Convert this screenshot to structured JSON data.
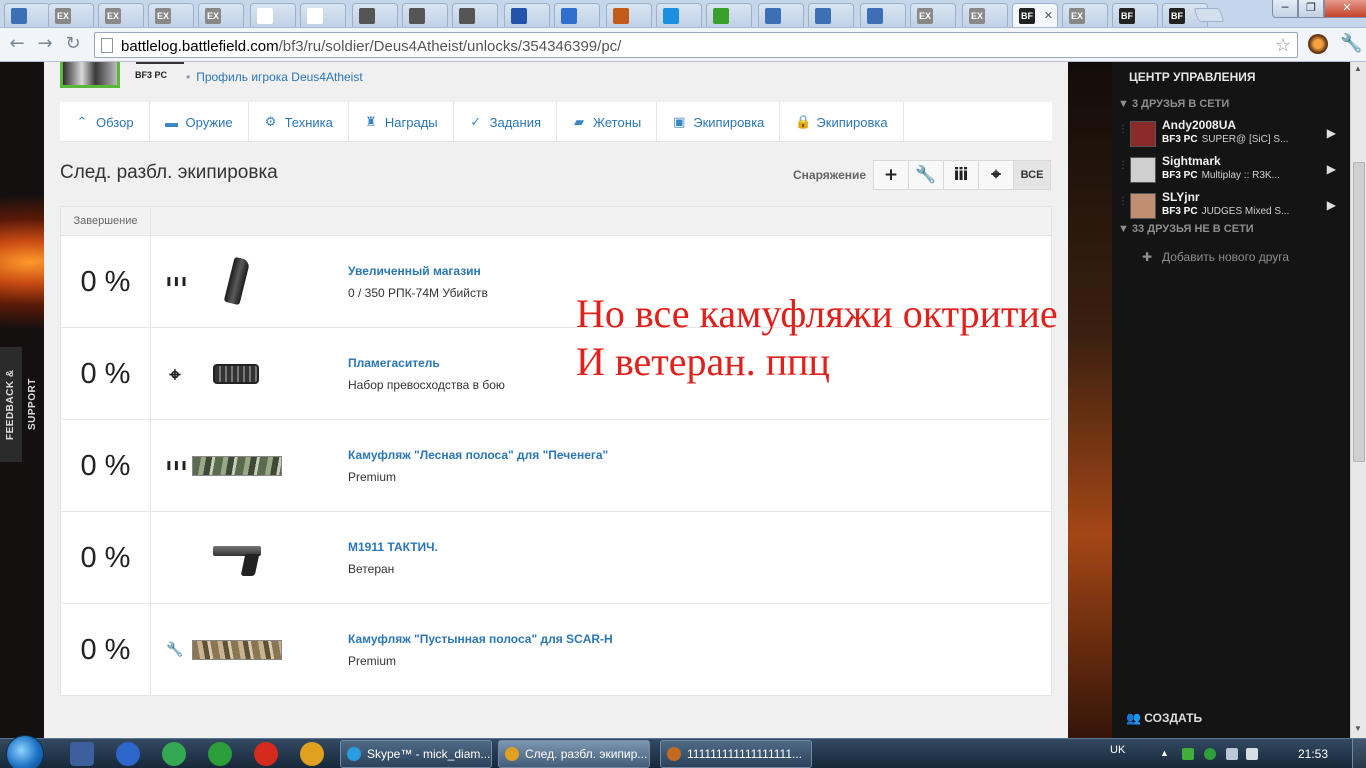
{
  "browser": {
    "tabs": [
      {
        "label": "",
        "icon": "pause-icon",
        "color": "#3d6fb5"
      },
      {
        "label": "EX",
        "icon": "ex-icon",
        "color": "#888888"
      },
      {
        "label": "EX",
        "icon": "ex-icon",
        "color": "#888888"
      },
      {
        "label": "EX",
        "icon": "ex-icon",
        "color": "#888888"
      },
      {
        "label": "EX",
        "icon": "ex-icon",
        "color": "#888888"
      },
      {
        "label": "",
        "icon": "page-icon",
        "color": "#ffffff"
      },
      {
        "label": "",
        "icon": "page-icon",
        "color": "#ffffff"
      },
      {
        "label": "",
        "icon": "hat-icon",
        "color": "#555555"
      },
      {
        "label": "",
        "icon": "hat-icon",
        "color": "#555555"
      },
      {
        "label": "",
        "icon": "hat-icon",
        "color": "#555555"
      },
      {
        "label": "",
        "icon": "globe-icon",
        "color": "#2255aa"
      },
      {
        "label": "",
        "icon": "flag-icon",
        "color": "#2f6fd0"
      },
      {
        "label": "",
        "icon": "dish-icon",
        "color": "#c25a1a"
      },
      {
        "label": "",
        "icon": "b-icon",
        "color": "#1c8fe0"
      },
      {
        "label": "",
        "icon": "smiley-icon",
        "color": "#39a02c"
      },
      {
        "label": "",
        "icon": "pause-icon",
        "color": "#3d6fb5"
      },
      {
        "label": "",
        "icon": "b-icon",
        "color": "#3d6fb5"
      },
      {
        "label": "",
        "icon": "pause-icon",
        "color": "#3d6fb5"
      },
      {
        "label": "EX",
        "icon": "ex-icon",
        "color": "#888888"
      },
      {
        "label": "EX",
        "icon": "ex-icon",
        "color": "#888888"
      },
      {
        "label": "BF",
        "icon": "bf-icon",
        "color": "#222222"
      },
      {
        "label": "EX",
        "icon": "ex-icon",
        "color": "#888888"
      },
      {
        "label": "BF",
        "icon": "bf-icon",
        "color": "#222222"
      },
      {
        "label": "BF",
        "icon": "bf-icon",
        "color": "#222222"
      }
    ],
    "url_host": "battlelog.battlefield.com",
    "url_path": "/bf3/ru/soldier/Deus4Atheist/unlocks/354346399/pc/",
    "window": {
      "minimize": "─",
      "maximize": "❐",
      "close": "✕"
    }
  },
  "page": {
    "feedback_tab": "FEEDBACK & SUPPORT",
    "profile": {
      "platform": "BF3 PC",
      "link": "Профиль игрока Deus4Atheist"
    },
    "nav": [
      {
        "label": "Обзор",
        "icon": "chevrons-up-icon"
      },
      {
        "label": "Оружие",
        "icon": "gun-icon"
      },
      {
        "label": "Техника",
        "icon": "gear-icon"
      },
      {
        "label": "Награды",
        "icon": "medal-icon"
      },
      {
        "label": "Задания",
        "icon": "check-icon"
      },
      {
        "label": "Жетоны",
        "icon": "dogtag-icon"
      },
      {
        "label": "Экипировка",
        "icon": "briefcase-icon"
      },
      {
        "label": "Экипировка",
        "icon": "lock-icon"
      }
    ],
    "section_title": "След. разбл. экипировка",
    "filter_label": "Снаряжение",
    "filters": [
      {
        "label": "+",
        "name": "filter-plus-button"
      },
      {
        "label": "🔧",
        "name": "filter-wrench-button"
      },
      {
        "label": "ⅲ",
        "name": "filter-ammo-button"
      },
      {
        "label": "⌖",
        "name": "filter-crosshair-button"
      },
      {
        "label": "ВСЕ",
        "name": "filter-all-button"
      }
    ],
    "table": {
      "header": "Завершение",
      "rows": [
        {
          "percent": "0 %",
          "category_icon": "ammo-icon",
          "category_glyph": "❚❚❚",
          "image": "mag",
          "name": "Увеличенный магазин",
          "desc": "0 / 350 РПК-74М Убийств",
          "progress": 0
        },
        {
          "percent": "0 %",
          "category_icon": "crosshair-icon",
          "category_glyph": "⌖",
          "image": "flash",
          "name": "Пламегаситель",
          "desc": "Набор превосходства в бою",
          "progress": 0
        },
        {
          "percent": "0 %",
          "category_icon": "ammo-icon",
          "category_glyph": "❚❚❚",
          "image": "camo1",
          "name": "Камуфляж \"Лесная полоса\" для \"Печенега\"",
          "desc": "Premium",
          "progress": 0
        },
        {
          "percent": "0 %",
          "category_icon": "",
          "category_glyph": "",
          "image": "pistol",
          "name": "M1911 ТАКТИЧ.",
          "desc": "Ветеран",
          "progress": 0
        },
        {
          "percent": "0 %",
          "category_icon": "wrench-icon",
          "category_glyph": "🔧",
          "image": "camo2",
          "name": "Камуфляж \"Пустынная полоса\" для SCAR-H",
          "desc": "Premium",
          "progress": 0
        }
      ]
    },
    "annotation": {
      "line1": "Но все камуфляжи октритие",
      "line2": "И ветеран. ппц"
    }
  },
  "command_center": {
    "title": "ЦЕНТР УПРАВЛЕНИЯ",
    "online_header": "▼ 3 ДРУЗЬЯ В СЕТИ",
    "friends": [
      {
        "name": "Andy2008UA",
        "platform": "BF3 PC",
        "status": "SUPER@ [SiC] S...",
        "avatar_color": "#8a2a2a"
      },
      {
        "name": "Sightmark",
        "platform": "BF3 PC",
        "status": "Multiplay :: R3K...",
        "avatar_color": "#cfcfcf"
      },
      {
        "name": "SLYjnr",
        "platform": "BF3 PC",
        "status": "JUDGES Mixed S...",
        "avatar_color": "#c08f72"
      }
    ],
    "offline_header": "▼ 33 ДРУЗЬЯ НЕ В СЕТИ",
    "add_friend": "Добавить нового друга",
    "create": "СОЗДАТЬ"
  },
  "taskbar": {
    "windows": [
      {
        "label": "Skype™ - mick_diam...",
        "color": "#2a9de0"
      },
      {
        "label": "След. разбл. экипир...",
        "color": "#e0a020"
      },
      {
        "label": "111111111111111111...",
        "color": "#c26a20"
      }
    ],
    "lang": "UK",
    "time": "21:53"
  }
}
